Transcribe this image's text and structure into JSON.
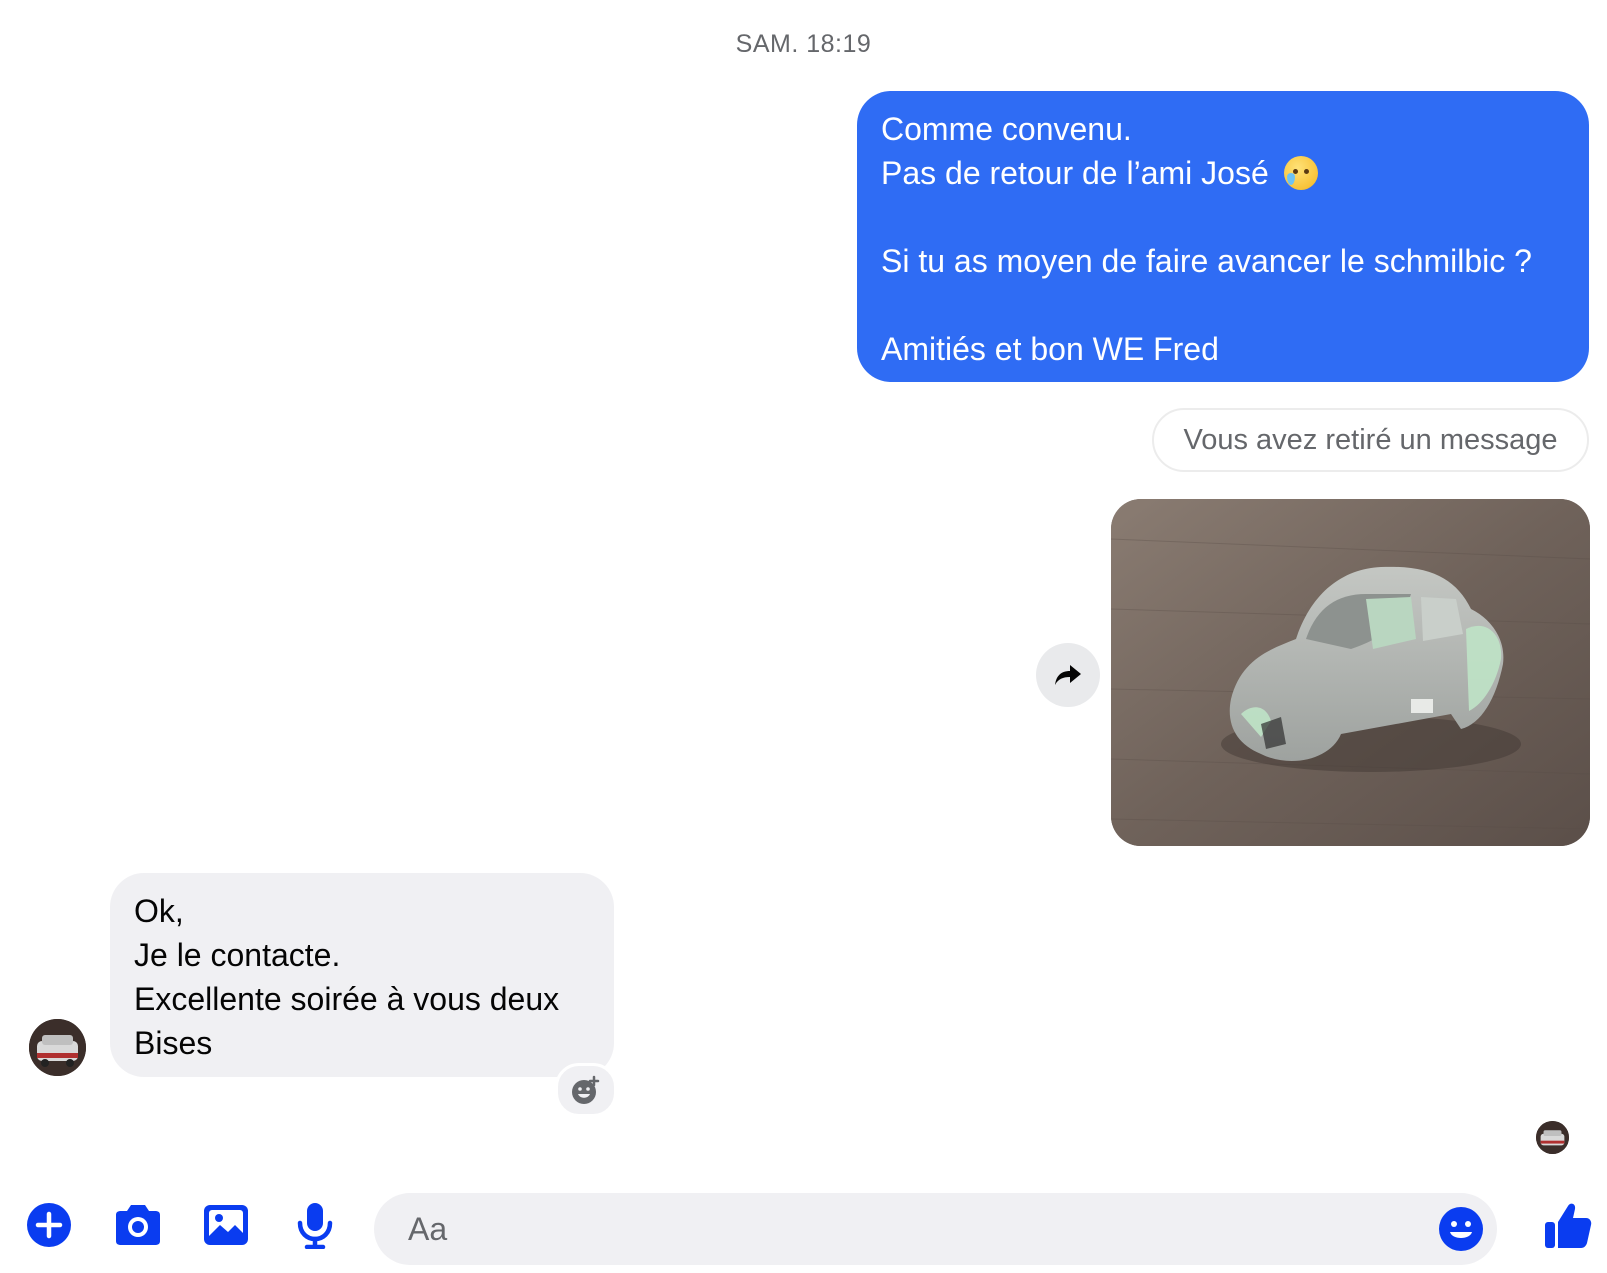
{
  "thread": {
    "timestamp": "SAM. 18:19"
  },
  "messages": {
    "outgoing_text": {
      "lines_before_emoji": "Comme convenu.\nPas de retour de l’ami José ",
      "emoji": "crying-face-emoji",
      "lines_after_emoji": "\n\nSi tu as moyen de faire avancer le schmilbic ?\n\nAmitiés et bon WE Fred"
    },
    "retracted_notice": "Vous avez retiré un message",
    "outgoing_photo": {
      "icon": "car-body-model-photo"
    },
    "incoming_text": "Ok,\nJe le contacte.\nExcellente soirée à vous deux\nBises"
  },
  "composer": {
    "placeholder": "Aa",
    "value": ""
  },
  "icons": {
    "add": "plus-circle-icon",
    "camera": "camera-icon",
    "gallery": "image-icon",
    "voice": "microphone-icon",
    "emoji": "smiley-icon",
    "like": "thumbs-up-icon",
    "share": "share-arrow-icon",
    "react": "add-reaction-icon"
  },
  "colors": {
    "accent": "#0a3cf0",
    "outgoing_bubble": "#2f6cf4",
    "incoming_bubble": "#f0f0f3",
    "meta_text": "#65676b"
  }
}
